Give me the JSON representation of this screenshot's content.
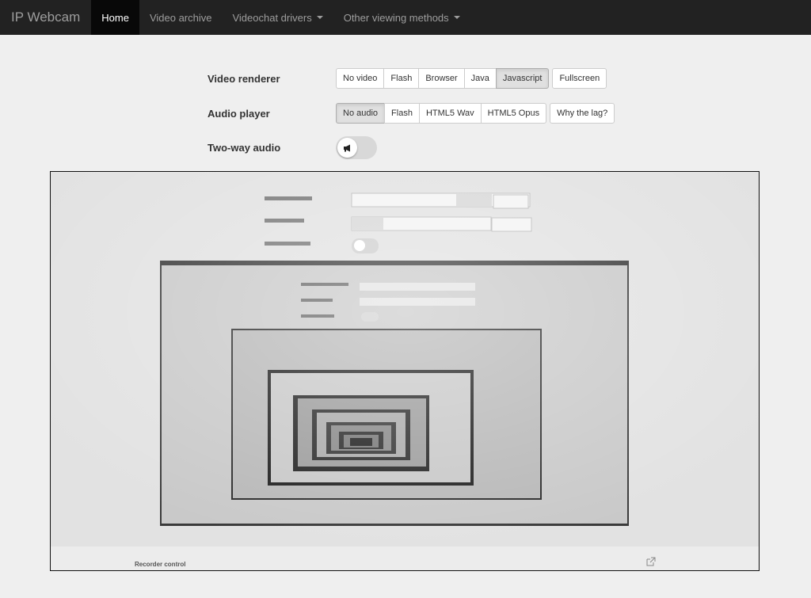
{
  "navbar": {
    "brand": "IP Webcam",
    "items": [
      {
        "label": "Home",
        "active": true,
        "dropdown": false
      },
      {
        "label": "Video archive",
        "active": false,
        "dropdown": false
      },
      {
        "label": "Videochat drivers",
        "active": false,
        "dropdown": true
      },
      {
        "label": "Other viewing methods",
        "active": false,
        "dropdown": true
      }
    ]
  },
  "controls": {
    "video_renderer": {
      "label": "Video renderer",
      "options": [
        "No video",
        "Flash",
        "Browser",
        "Java",
        "Javascript"
      ],
      "selected": "Javascript",
      "extra": "Fullscreen"
    },
    "audio_player": {
      "label": "Audio player",
      "options": [
        "No audio",
        "Flash",
        "HTML5 Wav",
        "HTML5 Opus"
      ],
      "selected": "No audio",
      "extra": "Why the lag?"
    },
    "two_way_audio": {
      "label": "Two-way audio",
      "icon": "megaphone-icon",
      "enabled": false
    }
  },
  "video": {
    "recorder_label": "Recorder control"
  },
  "colors": {
    "navbar_bg": "#222222",
    "navbar_active_bg": "#080808",
    "page_bg": "#efefef"
  }
}
